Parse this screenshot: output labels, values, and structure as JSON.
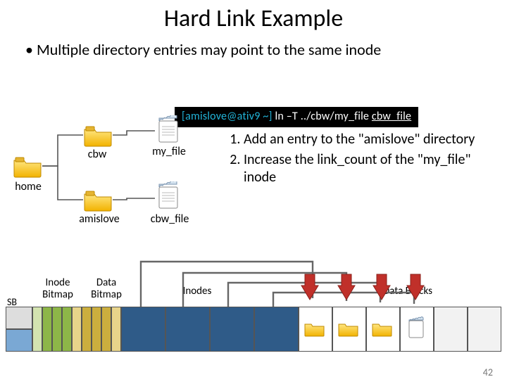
{
  "title": "Hard Link Example",
  "bullet": "Multiple directory entries may point to the same inode",
  "terminal": {
    "prefix": "[amislove@ativ9 ~]",
    "cmd": " ln –T ../cbw/my_file ",
    "arg_underlined": "cbw_file"
  },
  "tree": {
    "home": "home",
    "cbw": "cbw",
    "amislove": "amislove",
    "my_file": "my_file",
    "cbw_file": "cbw_file"
  },
  "steps": {
    "s1": "Add an entry to the \"amislove\" directory",
    "s2": "Increase the link_count of the \"my_file\" inode"
  },
  "strip": {
    "sb": "SB",
    "inode_bitmap": "Inode Bitmap",
    "data_bitmap": "Data Bitmap",
    "inodes": "Inodes",
    "data_blocks": "Data Blocks"
  },
  "page_number": "42"
}
